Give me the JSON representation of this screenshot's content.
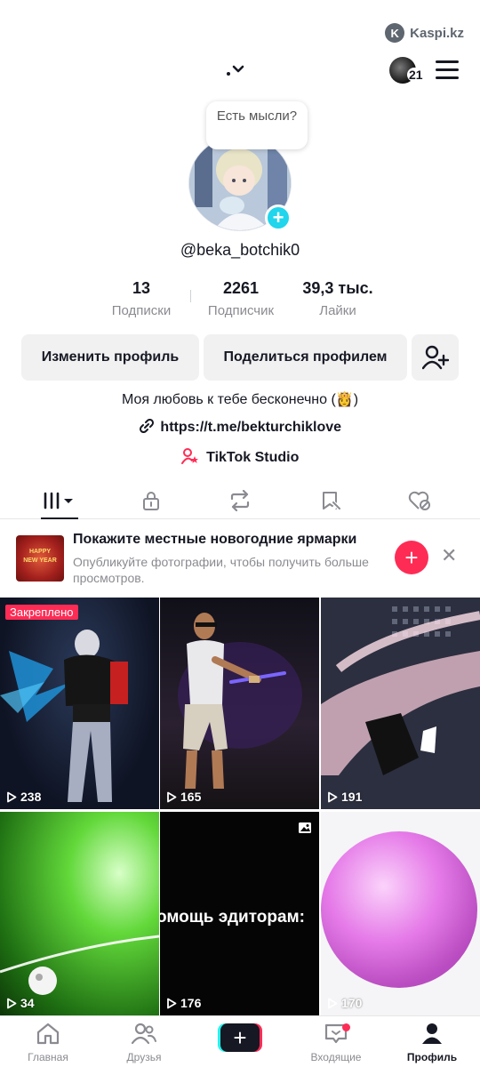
{
  "watermark": {
    "logo_letter": "K",
    "text": "Kaspi.kz"
  },
  "topbar": {
    "account_switch_glyph": "⌄",
    "notification_count": "21"
  },
  "profile": {
    "note_bubble": "Есть мысли?",
    "username": "@beka_botchik0",
    "stats": [
      {
        "value": "13",
        "label": "Подписки"
      },
      {
        "value": "2261",
        "label": "Подписчик"
      },
      {
        "value": "39,3 тыс.",
        "label": "Лайки"
      }
    ],
    "edit_label": "Изменить профиль",
    "share_label": "Поделиться профилем",
    "bio": "Моя любовь к тебе бесконечно (👸)",
    "link": "https://t.me/bekturchiklove",
    "studio": "TikTok Studio"
  },
  "tabs": [
    {
      "icon": "videos-grid-icon",
      "active": true
    },
    {
      "icon": "lock-icon",
      "active": false
    },
    {
      "icon": "repost-icon",
      "active": false
    },
    {
      "icon": "saved-icon",
      "active": false
    },
    {
      "icon": "liked-icon",
      "active": false
    }
  ],
  "promo": {
    "title": "Покажите местные новогодние ярмарки",
    "subtitle": "Опубликуйте фотографии, чтобы получить больше просмотров.",
    "thumb_text": "HAPPY NEW YEAR"
  },
  "videos": [
    {
      "views": "238",
      "pinned_label": "Закреплено"
    },
    {
      "views": "165"
    },
    {
      "views": "191"
    },
    {
      "views": "34"
    },
    {
      "views": "176",
      "overlay_text": "омощь эдиторам:"
    },
    {
      "views": "170"
    }
  ],
  "bottom_nav": [
    {
      "label": "Главная",
      "icon": "home-icon"
    },
    {
      "label": "Друзья",
      "icon": "friends-icon"
    },
    {
      "label": "",
      "icon": "create-icon"
    },
    {
      "label": "Входящие",
      "icon": "inbox-icon"
    },
    {
      "label": "Профиль",
      "icon": "profile-icon"
    }
  ],
  "colors": {
    "accent": "#fe2c55",
    "cyan": "#25f4ee",
    "text": "#161823",
    "muted": "#8a8b91"
  }
}
